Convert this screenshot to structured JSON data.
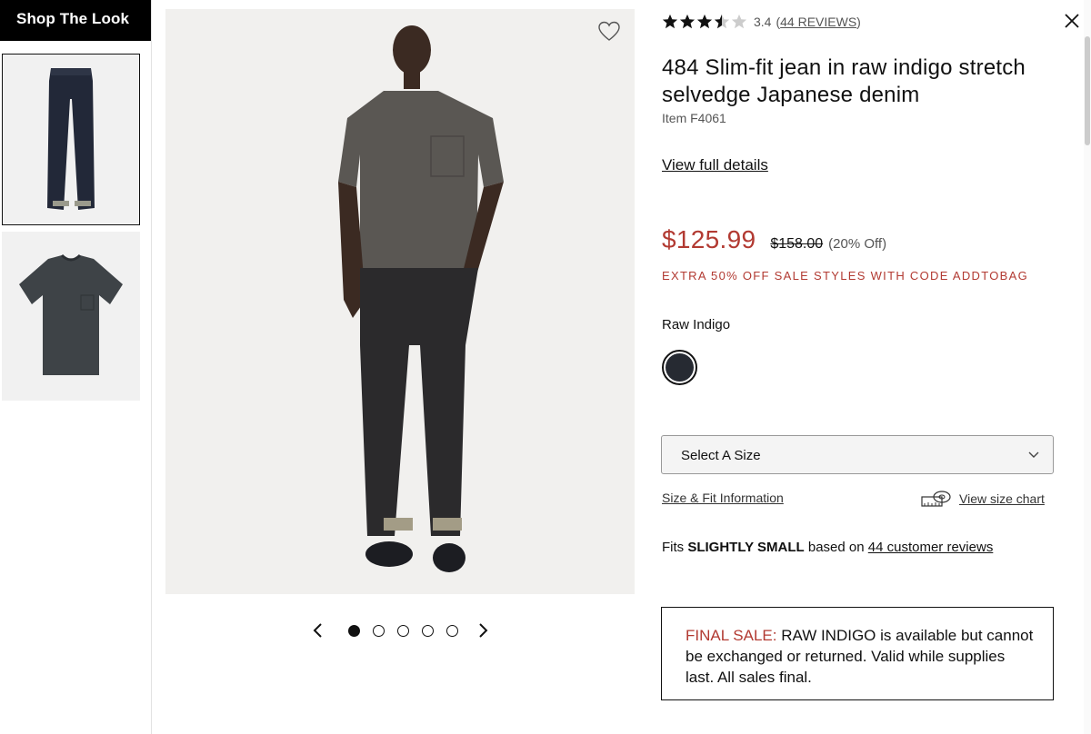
{
  "shop_the_look": {
    "title": "Shop The Look"
  },
  "rating": {
    "score": "3.4",
    "stars": 3.4,
    "reviews_link": "44 REVIEWS",
    "open_paren": "(",
    "close_paren": ")"
  },
  "product": {
    "title": "484 Slim-fit jean in raw indigo stretch selvedge Japanese denim",
    "item_number": "Item F4061",
    "view_full_details": "View full details"
  },
  "pricing": {
    "sale_price": "$125.99",
    "original_price": "$158.00",
    "discount": "(20% Off)",
    "promo": "EXTRA 50% OFF SALE STYLES WITH CODE ADDTOBAG"
  },
  "color": {
    "name": "Raw Indigo",
    "swatch_hex": "#262a32"
  },
  "size": {
    "select_label": "Select A Size",
    "fit_info_link": "Size & Fit Information",
    "size_chart_link": "View size chart"
  },
  "fit": {
    "prefix": "Fits",
    "emphasis": "SLIGHTLY SMALL",
    "middle": "based on",
    "link": "44 customer reviews"
  },
  "final_sale": {
    "label": "FINAL SALE:",
    "text": "RAW INDIGO is available but cannot be exchanged or returned. Valid while supplies last. All sales final."
  },
  "carousel": {
    "total": 5,
    "active": 1
  },
  "colors": {
    "accent_red": "#b23a32",
    "text": "#111111"
  }
}
